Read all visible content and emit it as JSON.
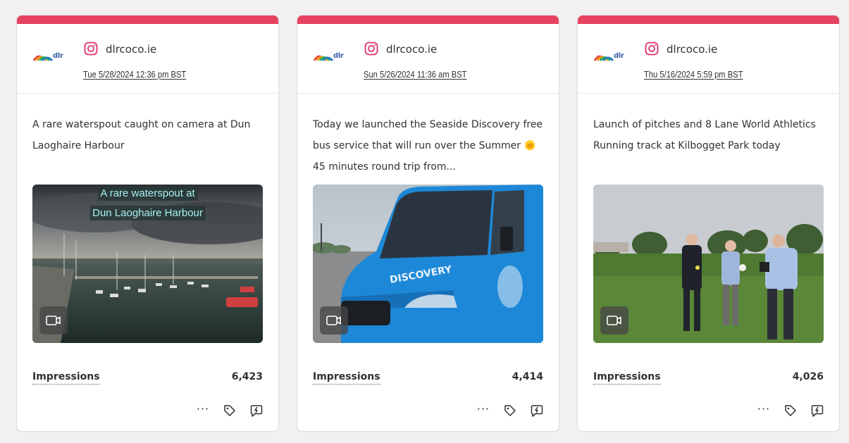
{
  "colors": {
    "accent_bar": "#e64361",
    "text": "#323130",
    "overlay_text": "#a7f0ef"
  },
  "metric_label": "Impressions",
  "cards": [
    {
      "account": "dlrcoco.ie",
      "platform_icon": "instagram-icon",
      "logo_text": "dlr",
      "date": "Tue 5/28/2024 12:36 pm BST",
      "caption": "A rare waterspout caught on camera at Dun Laoghaire Harbour",
      "media_overlay": [
        "A rare waterspout at",
        "Dun Laoghaire Harbour"
      ],
      "impressions": "6,423"
    },
    {
      "account": "dlrcoco.ie",
      "platform_icon": "instagram-icon",
      "logo_text": "dlr",
      "date": "Sun 5/26/2024 11:36 am BST",
      "caption": "Today we launched the Seaside Discovery free bus service that will run over the Summer 🌞 45 minutes round trip from...",
      "bus_text": "DISCOVERY",
      "impressions": "4,414"
    },
    {
      "account": "dlrcoco.ie",
      "platform_icon": "instagram-icon",
      "logo_text": "dlr",
      "date": "Thu 5/16/2024 5:59 pm BST",
      "caption": "Launch of pitches and 8 Lane World Athletics Running track at Kilbogget Park today",
      "impressions": "4,026"
    }
  ],
  "action_icons": [
    "more-icon",
    "tag-icon",
    "boost-icon"
  ]
}
